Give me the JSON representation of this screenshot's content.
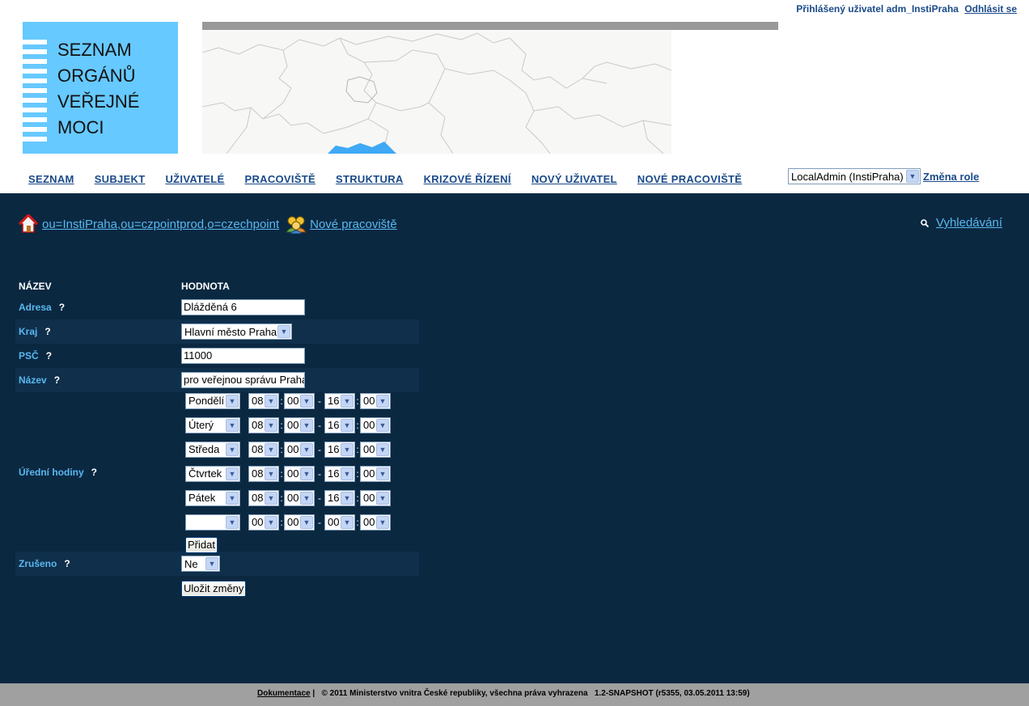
{
  "header": {
    "user_label": "Přihlášený uživatel adm_InstiPraha",
    "logout": "Odhlásit se",
    "logo_lines": [
      "SEZNAM",
      "ORGÁNŮ",
      "VEŘEJNÉ",
      "MOCI"
    ]
  },
  "nav": [
    "SEZNAM",
    "SUBJEKT",
    "UŽIVATELÉ",
    "PRACOVIŠTĚ",
    "STRUKTURA",
    "KRIZOVÉ ŘÍZENÍ",
    "NOVÝ UŽIVATEL",
    "NOVÉ PRACOVIŠTĚ"
  ],
  "role": {
    "selected": "LocalAdmin (InstiPraha)",
    "change": "Změna role"
  },
  "breadcrumb": {
    "path": "ou=InstiPraha,ou=czpointprod,o=czechpoint",
    "current": "Nové pracoviště",
    "home_icon": "house-icon",
    "workplace_icon": "people-icon"
  },
  "search": {
    "label": "Vyhledávání",
    "icon": "search-icon"
  },
  "form": {
    "col_name": "NÁZEV",
    "col_value": "HODNOTA",
    "help": "?",
    "address": {
      "label": "Adresa",
      "value": "Dlážděná 6"
    },
    "region": {
      "label": "Kraj",
      "value": "Hlavní město Praha"
    },
    "zip": {
      "label": "PSČ",
      "value": "11000"
    },
    "name": {
      "label": "Název",
      "value": "pro veřejnou správu Praha"
    },
    "office_hours": {
      "label": "Úřední hodiny",
      "rows": [
        {
          "day": "Pondělí",
          "from_h": "08",
          "from_m": "00",
          "to_h": "16",
          "to_m": "00"
        },
        {
          "day": "Úterý",
          "from_h": "08",
          "from_m": "00",
          "to_h": "16",
          "to_m": "00"
        },
        {
          "day": "Středa",
          "from_h": "08",
          "from_m": "00",
          "to_h": "16",
          "to_m": "00"
        },
        {
          "day": "Čtvrtek",
          "from_h": "08",
          "from_m": "00",
          "to_h": "16",
          "to_m": "00"
        },
        {
          "day": "Pátek",
          "from_h": "08",
          "from_m": "00",
          "to_h": "16",
          "to_m": "00"
        },
        {
          "day": "",
          "from_h": "00",
          "from_m": "00",
          "to_h": "00",
          "to_m": "00"
        }
      ],
      "time_sep": ":",
      "range_sep": "-",
      "add_button": "Přidat"
    },
    "cancelled": {
      "label": "Zrušeno",
      "value": "Ne"
    },
    "save_button": "Uložit změny"
  },
  "footer": {
    "docs": "Dokumentace",
    "divider": "|",
    "copyright": "© 2011 Ministerstvo vnitra České republiky, všechna práva vyhrazena",
    "version": "1.2-SNAPSHOT (r5355, 03.05.2011 13:59)"
  },
  "colors": {
    "main_bg": "#0b2841",
    "logo_bg": "#66c9ff",
    "link": "#5ab8f0",
    "nav": "#1a4a8a",
    "footer_bg": "#a0a0a0"
  }
}
